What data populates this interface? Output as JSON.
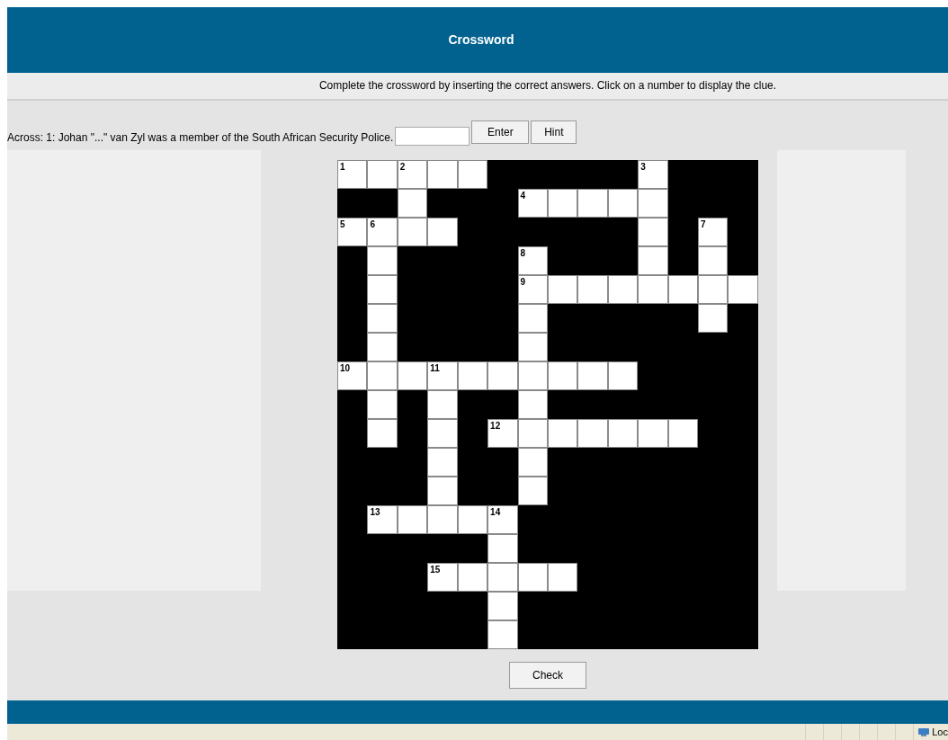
{
  "header": {
    "title": "Crossword"
  },
  "instructions": "Complete the crossword by inserting the correct answers. Click on a number to display the clue.",
  "clue": {
    "text": "Across: 1: Johan \"...\" van Zyl was a member of the South African Security Police.",
    "buttons": [
      "Enter",
      "Hint"
    ]
  },
  "grid": {
    "rows": [
      {
        "cells": [
          {
            "open": true,
            "number": "1"
          },
          {
            "open": true
          },
          {
            "open": true,
            "number": "2"
          },
          {
            "open": true
          },
          {
            "open": true
          },
          {
            "open": false
          },
          {
            "open": false
          },
          {
            "open": false
          },
          {
            "open": false
          },
          {
            "open": false
          },
          {
            "open": true,
            "number": "3"
          },
          {
            "open": false
          },
          {
            "open": false
          },
          {
            "open": false
          }
        ]
      },
      {
        "cells": [
          {
            "open": false
          },
          {
            "open": false
          },
          {
            "open": true
          },
          {
            "open": false
          },
          {
            "open": false
          },
          {
            "open": false
          },
          {
            "open": true,
            "number": "4"
          },
          {
            "open": true
          },
          {
            "open": true
          },
          {
            "open": true
          },
          {
            "open": true
          },
          {
            "open": false
          },
          {
            "open": false
          },
          {
            "open": false
          }
        ]
      },
      {
        "cells": [
          {
            "open": true,
            "number": "5"
          },
          {
            "open": true,
            "number": "6"
          },
          {
            "open": true
          },
          {
            "open": true
          },
          {
            "open": false
          },
          {
            "open": false
          },
          {
            "open": false
          },
          {
            "open": false
          },
          {
            "open": false
          },
          {
            "open": false
          },
          {
            "open": true
          },
          {
            "open": false
          },
          {
            "open": true,
            "number": "7"
          },
          {
            "open": false
          }
        ]
      },
      {
        "cells": [
          {
            "open": false
          },
          {
            "open": true
          },
          {
            "open": false
          },
          {
            "open": false
          },
          {
            "open": false
          },
          {
            "open": false
          },
          {
            "open": true,
            "number": "8"
          },
          {
            "open": false
          },
          {
            "open": false
          },
          {
            "open": false
          },
          {
            "open": true
          },
          {
            "open": false
          },
          {
            "open": true
          },
          {
            "open": false
          }
        ]
      },
      {
        "cells": [
          {
            "open": false
          },
          {
            "open": true
          },
          {
            "open": false
          },
          {
            "open": false
          },
          {
            "open": false
          },
          {
            "open": false
          },
          {
            "open": true,
            "number": "9"
          },
          {
            "open": true
          },
          {
            "open": true
          },
          {
            "open": true
          },
          {
            "open": true
          },
          {
            "open": true
          },
          {
            "open": true
          },
          {
            "open": true
          }
        ]
      },
      {
        "cells": [
          {
            "open": false
          },
          {
            "open": true
          },
          {
            "open": false
          },
          {
            "open": false
          },
          {
            "open": false
          },
          {
            "open": false
          },
          {
            "open": true
          },
          {
            "open": false
          },
          {
            "open": false
          },
          {
            "open": false
          },
          {
            "open": false
          },
          {
            "open": false
          },
          {
            "open": true
          },
          {
            "open": false
          }
        ]
      },
      {
        "cells": [
          {
            "open": false
          },
          {
            "open": true
          },
          {
            "open": false
          },
          {
            "open": false
          },
          {
            "open": false
          },
          {
            "open": false
          },
          {
            "open": true
          },
          {
            "open": false
          },
          {
            "open": false
          },
          {
            "open": false
          },
          {
            "open": false
          },
          {
            "open": false
          },
          {
            "open": false
          },
          {
            "open": false
          }
        ]
      },
      {
        "cells": [
          {
            "open": true,
            "number": "10"
          },
          {
            "open": true
          },
          {
            "open": true
          },
          {
            "open": true,
            "number": "11"
          },
          {
            "open": true
          },
          {
            "open": true
          },
          {
            "open": true
          },
          {
            "open": true
          },
          {
            "open": true
          },
          {
            "open": true
          },
          {
            "open": false
          },
          {
            "open": false
          },
          {
            "open": false
          },
          {
            "open": false
          }
        ]
      },
      {
        "cells": [
          {
            "open": false
          },
          {
            "open": true
          },
          {
            "open": false
          },
          {
            "open": true
          },
          {
            "open": false
          },
          {
            "open": false
          },
          {
            "open": true
          },
          {
            "open": false
          },
          {
            "open": false
          },
          {
            "open": false
          },
          {
            "open": false
          },
          {
            "open": false
          },
          {
            "open": false
          },
          {
            "open": false
          }
        ]
      },
      {
        "cells": [
          {
            "open": false
          },
          {
            "open": true
          },
          {
            "open": false
          },
          {
            "open": true
          },
          {
            "open": false
          },
          {
            "open": true,
            "number": "12"
          },
          {
            "open": true
          },
          {
            "open": true
          },
          {
            "open": true
          },
          {
            "open": true
          },
          {
            "open": true
          },
          {
            "open": true
          },
          {
            "open": false
          },
          {
            "open": false
          }
        ]
      },
      {
        "cells": [
          {
            "open": false
          },
          {
            "open": false
          },
          {
            "open": false
          },
          {
            "open": true
          },
          {
            "open": false
          },
          {
            "open": false
          },
          {
            "open": true
          },
          {
            "open": false
          },
          {
            "open": false
          },
          {
            "open": false
          },
          {
            "open": false
          },
          {
            "open": false
          },
          {
            "open": false
          },
          {
            "open": false
          }
        ]
      },
      {
        "cells": [
          {
            "open": false
          },
          {
            "open": false
          },
          {
            "open": false
          },
          {
            "open": true
          },
          {
            "open": false
          },
          {
            "open": false
          },
          {
            "open": true
          },
          {
            "open": false
          },
          {
            "open": false
          },
          {
            "open": false
          },
          {
            "open": false
          },
          {
            "open": false
          },
          {
            "open": false
          },
          {
            "open": false
          }
        ]
      },
      {
        "cells": [
          {
            "open": false
          },
          {
            "open": true,
            "number": "13"
          },
          {
            "open": true
          },
          {
            "open": true
          },
          {
            "open": true
          },
          {
            "open": true,
            "number": "14"
          },
          {
            "open": false
          },
          {
            "open": false
          },
          {
            "open": false
          },
          {
            "open": false
          },
          {
            "open": false
          },
          {
            "open": false
          },
          {
            "open": false
          },
          {
            "open": false
          }
        ]
      },
      {
        "cells": [
          {
            "open": false
          },
          {
            "open": false
          },
          {
            "open": false
          },
          {
            "open": false
          },
          {
            "open": false
          },
          {
            "open": true
          },
          {
            "open": false
          },
          {
            "open": false
          },
          {
            "open": false
          },
          {
            "open": false
          },
          {
            "open": false
          },
          {
            "open": false
          },
          {
            "open": false
          },
          {
            "open": false
          }
        ]
      },
      {
        "cells": [
          {
            "open": false
          },
          {
            "open": false
          },
          {
            "open": false
          },
          {
            "open": true,
            "number": "15"
          },
          {
            "open": true
          },
          {
            "open": true
          },
          {
            "open": true
          },
          {
            "open": true
          },
          {
            "open": false
          },
          {
            "open": false
          },
          {
            "open": false
          },
          {
            "open": false
          },
          {
            "open": false
          },
          {
            "open": false
          }
        ]
      },
      {
        "cells": [
          {
            "open": false
          },
          {
            "open": false
          },
          {
            "open": false
          },
          {
            "open": false
          },
          {
            "open": false
          },
          {
            "open": true
          },
          {
            "open": false
          },
          {
            "open": false
          },
          {
            "open": false
          },
          {
            "open": false
          },
          {
            "open": false
          },
          {
            "open": false
          },
          {
            "open": false
          },
          {
            "open": false
          }
        ]
      },
      {
        "cells": [
          {
            "open": false
          },
          {
            "open": false
          },
          {
            "open": false
          },
          {
            "open": false
          },
          {
            "open": false
          },
          {
            "open": true
          },
          {
            "open": false
          },
          {
            "open": false
          },
          {
            "open": false
          },
          {
            "open": false
          },
          {
            "open": false
          },
          {
            "open": false
          },
          {
            "open": false
          },
          {
            "open": false
          }
        ]
      }
    ]
  },
  "check_button": "Check",
  "status_bar": {
    "text": "Loc"
  }
}
